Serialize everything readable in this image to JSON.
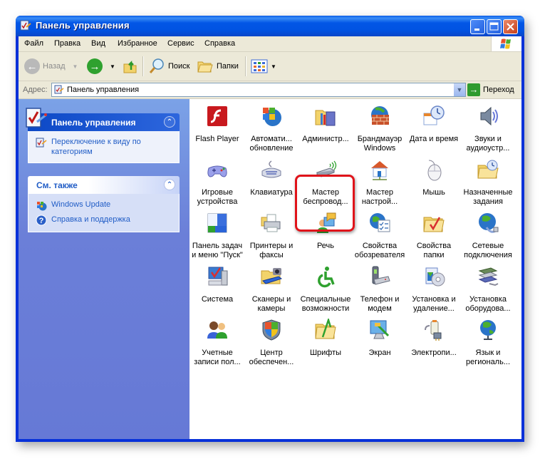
{
  "window": {
    "title": "Панель управления",
    "controls": [
      "minimize",
      "maximize",
      "close"
    ]
  },
  "menu": [
    "Файл",
    "Правка",
    "Вид",
    "Избранное",
    "Сервис",
    "Справка"
  ],
  "toolbar": {
    "back_label": "Назад",
    "search_label": "Поиск",
    "folders_label": "Папки"
  },
  "address": {
    "label": "Адрес:",
    "value": "Панель управления",
    "go_label": "Переход"
  },
  "sidebar": {
    "panels": [
      {
        "title": "Панель управления",
        "links": [
          {
            "label": "Переключение к виду по категориям",
            "icon": "control-panel-icon"
          }
        ]
      },
      {
        "title": "См. также",
        "links": [
          {
            "label": "Windows Update",
            "icon": "windows-update-icon"
          },
          {
            "label": "Справка и поддержка",
            "icon": "help-icon"
          }
        ]
      }
    ]
  },
  "items": [
    {
      "label": "Flash Player",
      "icon": "flash-icon",
      "selected": false
    },
    {
      "label": "Автомати... обновление",
      "icon": "auto-update-icon",
      "selected": false
    },
    {
      "label": "Администр...",
      "icon": "admin-tools-icon",
      "selected": true
    },
    {
      "label": "Брандмауэр Windows",
      "icon": "firewall-icon",
      "selected": false
    },
    {
      "label": "Дата и время",
      "icon": "date-time-icon",
      "selected": false
    },
    {
      "label": "Звуки и аудиоустр...",
      "icon": "sound-icon",
      "selected": false
    },
    {
      "label": "Игровые устройства",
      "icon": "gamepad-icon",
      "selected": false
    },
    {
      "label": "Клавиатура",
      "icon": "keyboard-icon",
      "selected": false
    },
    {
      "label": "Мастер беспровод...",
      "icon": "wireless-icon",
      "selected": false
    },
    {
      "label": "Мастер настрой...",
      "icon": "network-setup-icon",
      "selected": false
    },
    {
      "label": "Мышь",
      "icon": "mouse-icon",
      "selected": false
    },
    {
      "label": "Назначенные задания",
      "icon": "scheduled-tasks-icon",
      "selected": false
    },
    {
      "label": "Панель задач и меню \"Пуск\"",
      "icon": "taskbar-icon",
      "selected": false
    },
    {
      "label": "Принтеры и факсы",
      "icon": "printer-icon",
      "selected": false
    },
    {
      "label": "Речь",
      "icon": "speech-icon",
      "selected": false
    },
    {
      "label": "Свойства обозревателя",
      "icon": "internet-options-icon",
      "selected": false
    },
    {
      "label": "Свойства папки",
      "icon": "folder-options-icon",
      "selected": false
    },
    {
      "label": "Сетевые подключения",
      "icon": "network-connections-icon",
      "selected": false
    },
    {
      "label": "Система",
      "icon": "system-icon",
      "selected": false
    },
    {
      "label": "Сканеры и камеры",
      "icon": "scanner-icon",
      "selected": false
    },
    {
      "label": "Специальные возможности",
      "icon": "accessibility-icon",
      "selected": false
    },
    {
      "label": "Телефон и модем",
      "icon": "phone-modem-icon",
      "selected": false
    },
    {
      "label": "Установка и удаление...",
      "icon": "add-remove-icon",
      "selected": false
    },
    {
      "label": "Установка оборудова...",
      "icon": "add-hardware-icon",
      "selected": false
    },
    {
      "label": "Учетные записи пол...",
      "icon": "user-accounts-icon",
      "selected": false
    },
    {
      "label": "Центр обеспечен...",
      "icon": "security-center-icon",
      "selected": false
    },
    {
      "label": "Шрифты",
      "icon": "fonts-icon",
      "selected": false
    },
    {
      "label": "Экран",
      "icon": "display-icon",
      "selected": false
    },
    {
      "label": "Электропи...",
      "icon": "power-icon",
      "selected": false
    },
    {
      "label": "Язык и региональ...",
      "icon": "regional-icon",
      "selected": false
    }
  ],
  "colors": {
    "titlebar": "#0256e6",
    "sidebar": "#6b7fd8",
    "link": "#215dc6",
    "highlight": "#e0131a"
  }
}
